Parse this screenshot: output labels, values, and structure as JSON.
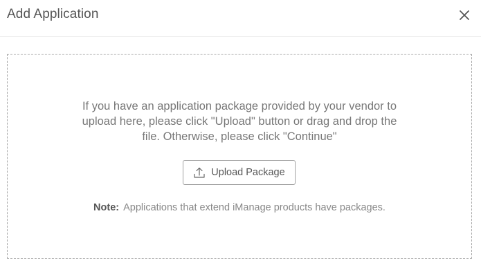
{
  "dialog": {
    "title": "Add Application",
    "close_icon": "close-icon"
  },
  "dropzone": {
    "instructions": [
      "If you have an application package provided by your vendor to",
      "upload here, please click \"Upload\" button or drag and drop the",
      "file. Otherwise, please click \"Continue\""
    ],
    "upload_button": {
      "label": "Upload Package",
      "icon": "upload-icon"
    },
    "note": {
      "label": "Note:",
      "text": "Applications that extend iManage products have packages."
    }
  },
  "colors": {
    "text_primary": "#555555",
    "text_secondary": "#777777",
    "border_dashed": "#a8a8a8",
    "divider": "#e6e6e6"
  }
}
